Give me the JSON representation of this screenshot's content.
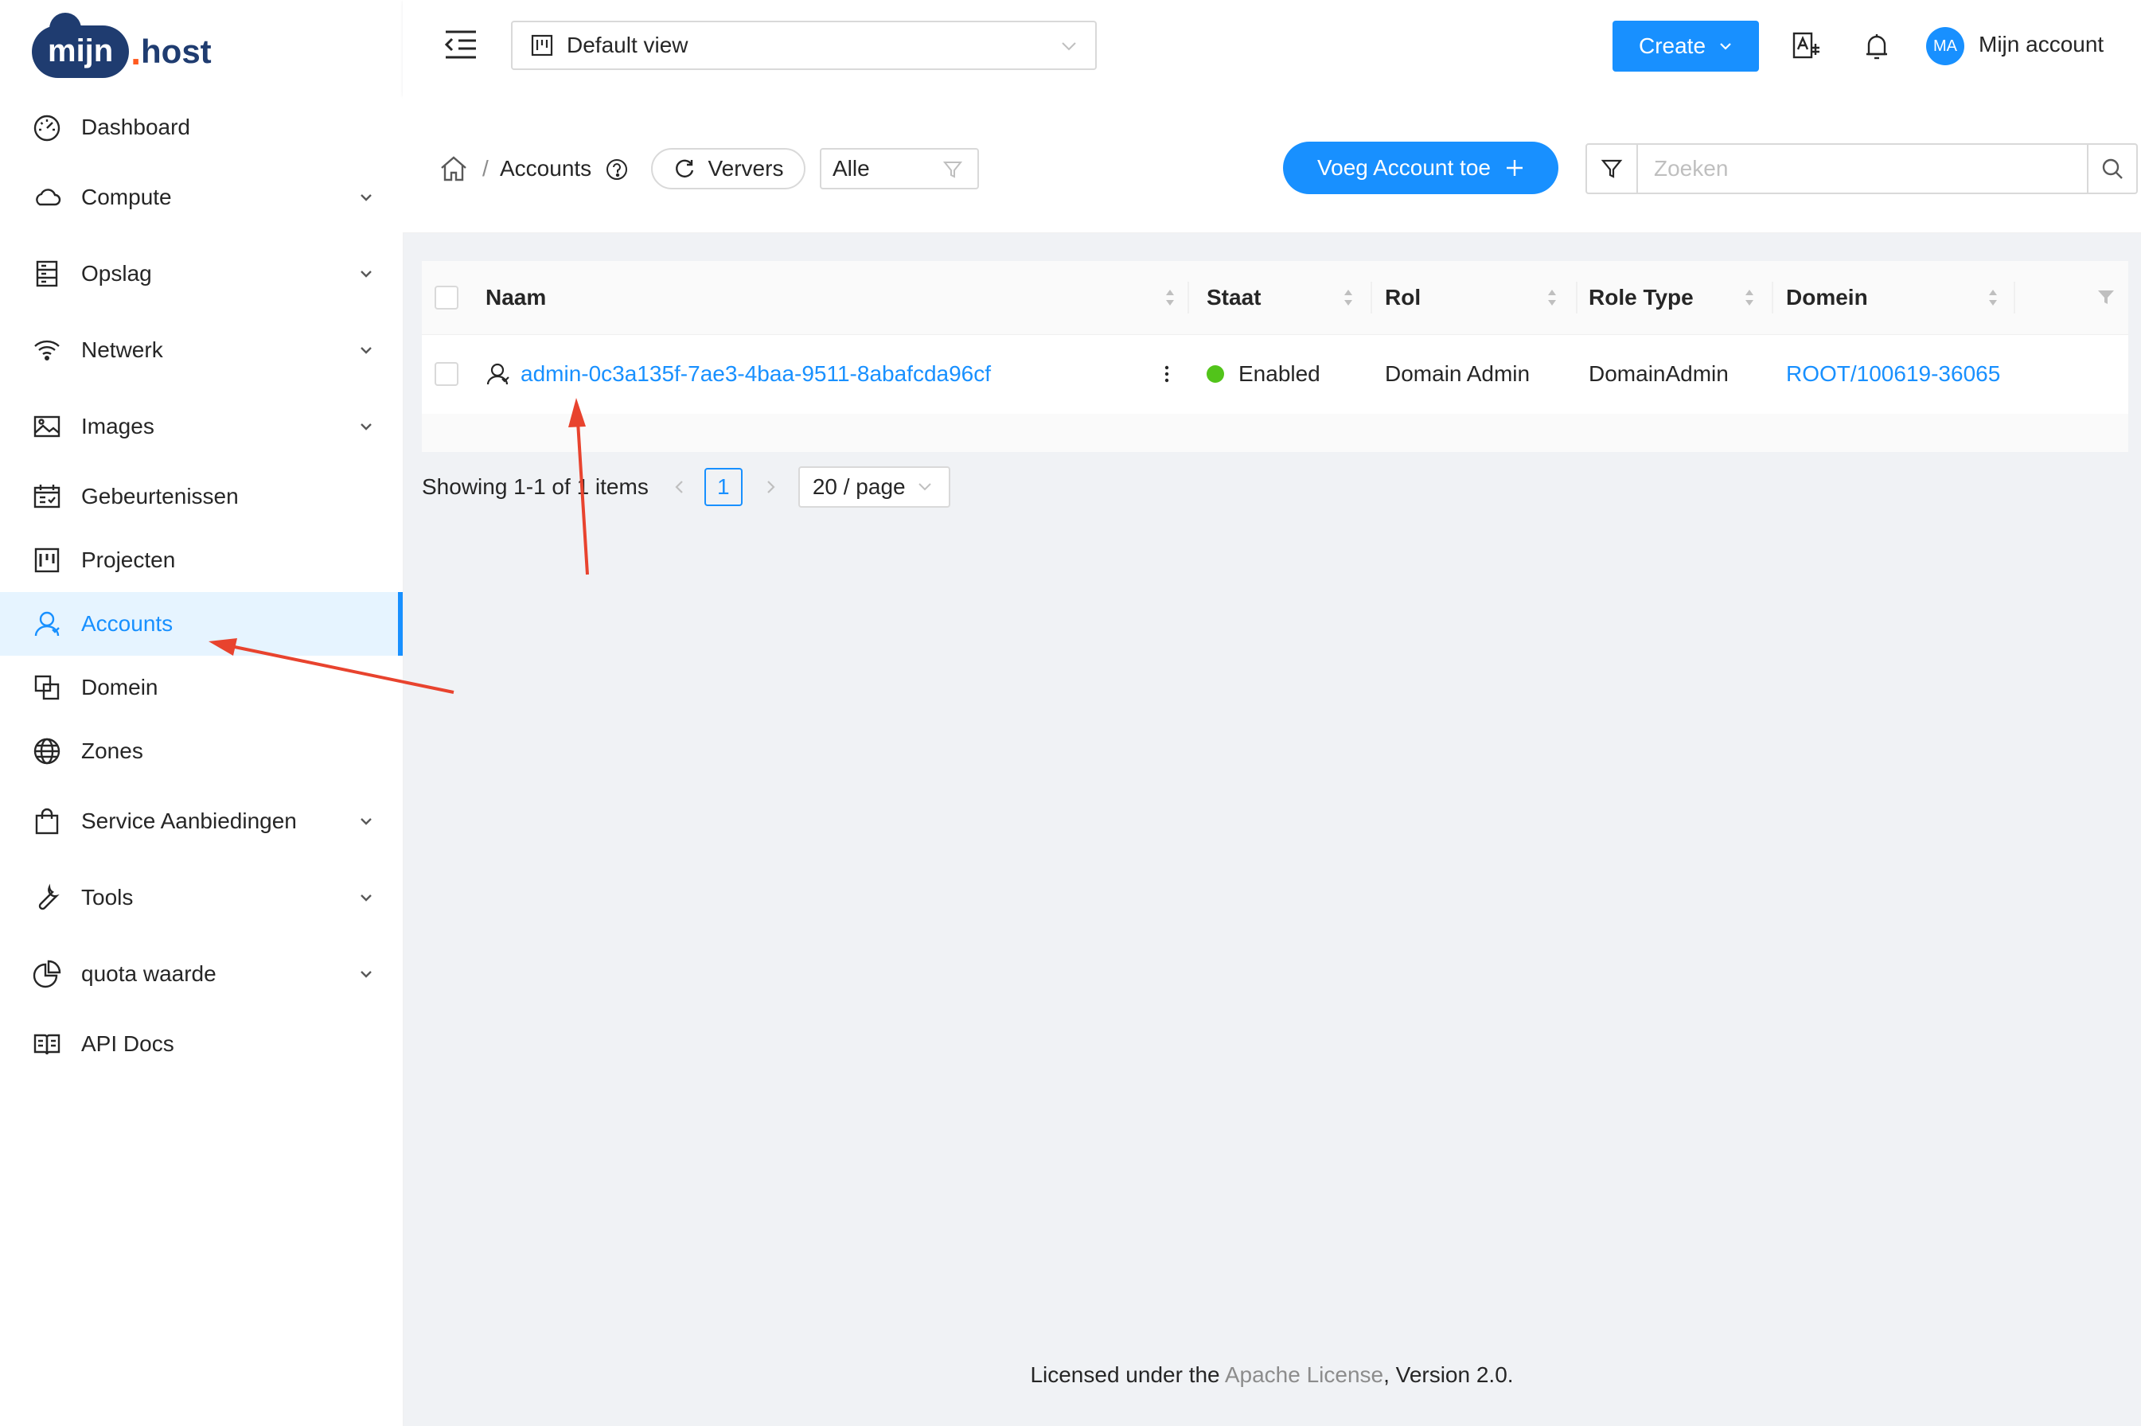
{
  "brand": {
    "logo_main": "mijn",
    "logo_dot": ".",
    "logo_host": "host"
  },
  "sidebar": {
    "items": [
      {
        "label": "Dashboard",
        "icon": "dashboard-icon",
        "expandable": false
      },
      {
        "label": "Compute",
        "icon": "cloud-icon",
        "expandable": true
      },
      {
        "label": "Opslag",
        "icon": "storage-icon",
        "expandable": true
      },
      {
        "label": "Netwerk",
        "icon": "wifi-icon",
        "expandable": true
      },
      {
        "label": "Images",
        "icon": "picture-icon",
        "expandable": true
      },
      {
        "label": "Gebeurtenissen",
        "icon": "schedule-icon",
        "expandable": false
      },
      {
        "label": "Projecten",
        "icon": "project-icon",
        "expandable": false
      },
      {
        "label": "Accounts",
        "icon": "user-icon",
        "expandable": false,
        "active": true
      },
      {
        "label": "Domein",
        "icon": "block-icon",
        "expandable": false
      },
      {
        "label": "Zones",
        "icon": "globe-icon",
        "expandable": false
      },
      {
        "label": "Service Aanbiedingen",
        "icon": "shopping-icon",
        "expandable": true
      },
      {
        "label": "Tools",
        "icon": "tool-icon",
        "expandable": true
      },
      {
        "label": "quota waarde",
        "icon": "pie-chart-icon",
        "expandable": true
      },
      {
        "label": "API Docs",
        "icon": "read-icon",
        "expandable": false
      }
    ]
  },
  "header": {
    "view_select": "Default view",
    "create_label": "Create",
    "account_initials": "MA",
    "account_name": "Mijn account"
  },
  "toolbar": {
    "breadcrumb_sep": "/",
    "breadcrumb_current": "Accounts",
    "refresh_label": "Ververs",
    "filter_value": "Alle",
    "add_label": "Voeg Account toe",
    "search_placeholder": "Zoeken"
  },
  "table": {
    "columns": [
      "Naam",
      "Staat",
      "Rol",
      "Role Type",
      "Domein"
    ],
    "rows": [
      {
        "naam": "admin-0c3a135f-7ae3-4baa-9511-8abafcda96cf",
        "staat": "Enabled",
        "rol": "Domain Admin",
        "role_type": "DomainAdmin",
        "domein": "ROOT/100619-36065"
      }
    ]
  },
  "pagination": {
    "summary": "Showing 1-1 of 1 items",
    "current_page": "1",
    "page_size": "20 / page"
  },
  "footer": {
    "prefix": "Licensed under the",
    "link": "Apache License",
    "suffix": ", Version 2.0."
  },
  "colors": {
    "primary": "#1890ff",
    "enabled": "#52c41a",
    "annotation_arrow": "#e8432e",
    "brand_navy": "#1f3c70",
    "brand_orange": "#ff5a1f"
  }
}
